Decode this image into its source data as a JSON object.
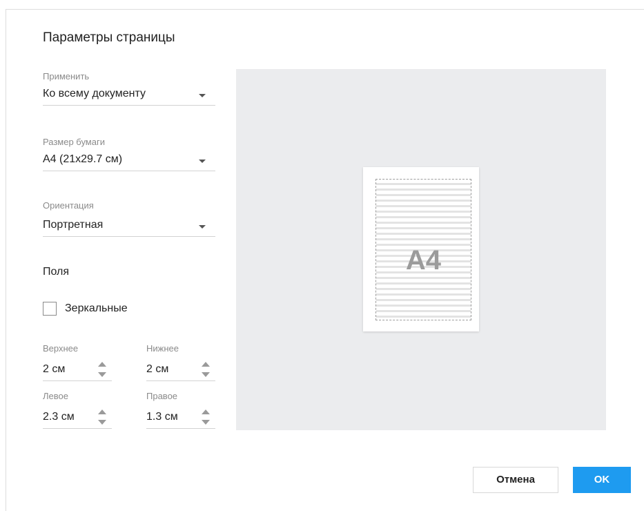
{
  "dialog": {
    "title": "Параметры страницы",
    "apply": {
      "label": "Применить",
      "value": "Ко всему документу"
    },
    "paper_size": {
      "label": "Размер бумаги",
      "value": "A4 (21x29.7 см)"
    },
    "orientation": {
      "label": "Ориентация",
      "value": "Портретная"
    },
    "margins": {
      "title": "Поля",
      "mirror_label": "Зеркальные",
      "mirror_checked": false,
      "top": {
        "label": "Верхнее",
        "value": "2 см"
      },
      "bottom": {
        "label": "Нижнее",
        "value": "2 см"
      },
      "left": {
        "label": "Левое",
        "value": "2.3 см"
      },
      "right": {
        "label": "Правое",
        "value": "1.3 см"
      }
    },
    "preview": {
      "paper_label": "A4"
    },
    "buttons": {
      "cancel": "Отмена",
      "ok": "OK"
    }
  },
  "colors": {
    "accent": "#1e9bf0",
    "preview_bg": "#ebecee",
    "label_gray": "#8a8a8a"
  },
  "icons": [
    "caret-down-icon",
    "spin-up-icon",
    "spin-down-icon",
    "checkbox-icon"
  ]
}
